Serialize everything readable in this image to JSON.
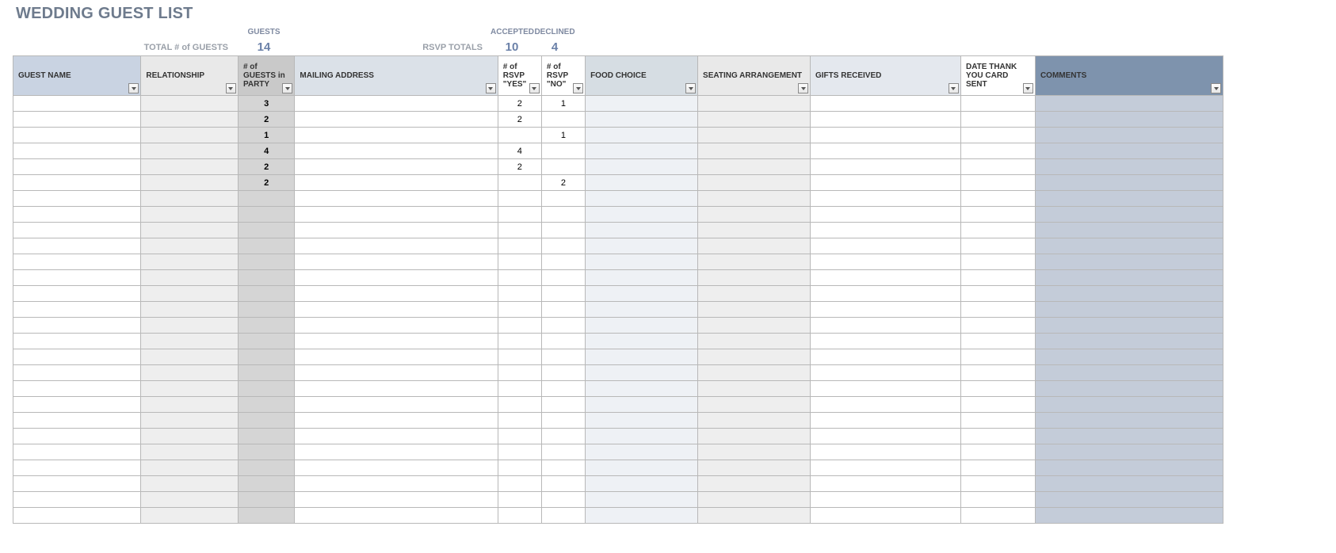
{
  "title": "WEDDING GUEST LIST",
  "summary": {
    "guests_label": "GUESTS",
    "total_label": "TOTAL # of GUESTS",
    "total_value": "14",
    "rsvp_totals_label": "RSVP TOTALS",
    "accepted_label": "ACCEPTED",
    "accepted_value": "10",
    "declined_label": "DECLINED",
    "declined_value": "4"
  },
  "columns": {
    "name": "GUEST NAME",
    "rel": "RELATIONSHIP",
    "party": "# of GUESTS in PARTY",
    "mail": "MAILING ADDRESS",
    "yes": "# of RSVP \"YES\"",
    "no": "# of RSVP \"NO\"",
    "food": "FOOD CHOICE",
    "seat": "SEATING ARRANGEMENT",
    "gift": "GIFTS RECEIVED",
    "thank": "DATE THANK YOU CARD SENT",
    "comm": "COMMENTS"
  },
  "rows": [
    {
      "party": "3",
      "yes": "2",
      "no": "1"
    },
    {
      "party": "2",
      "yes": "2",
      "no": ""
    },
    {
      "party": "1",
      "yes": "",
      "no": "1"
    },
    {
      "party": "4",
      "yes": "4",
      "no": ""
    },
    {
      "party": "2",
      "yes": "2",
      "no": ""
    },
    {
      "party": "2",
      "yes": "",
      "no": "2"
    },
    {
      "party": "",
      "yes": "",
      "no": ""
    },
    {
      "party": "",
      "yes": "",
      "no": ""
    },
    {
      "party": "",
      "yes": "",
      "no": ""
    },
    {
      "party": "",
      "yes": "",
      "no": ""
    },
    {
      "party": "",
      "yes": "",
      "no": ""
    },
    {
      "party": "",
      "yes": "",
      "no": ""
    },
    {
      "party": "",
      "yes": "",
      "no": ""
    },
    {
      "party": "",
      "yes": "",
      "no": ""
    },
    {
      "party": "",
      "yes": "",
      "no": ""
    },
    {
      "party": "",
      "yes": "",
      "no": ""
    },
    {
      "party": "",
      "yes": "",
      "no": ""
    },
    {
      "party": "",
      "yes": "",
      "no": ""
    },
    {
      "party": "",
      "yes": "",
      "no": ""
    },
    {
      "party": "",
      "yes": "",
      "no": ""
    },
    {
      "party": "",
      "yes": "",
      "no": ""
    },
    {
      "party": "",
      "yes": "",
      "no": ""
    },
    {
      "party": "",
      "yes": "",
      "no": ""
    },
    {
      "party": "",
      "yes": "",
      "no": ""
    },
    {
      "party": "",
      "yes": "",
      "no": ""
    },
    {
      "party": "",
      "yes": "",
      "no": ""
    },
    {
      "party": "",
      "yes": "",
      "no": ""
    }
  ]
}
